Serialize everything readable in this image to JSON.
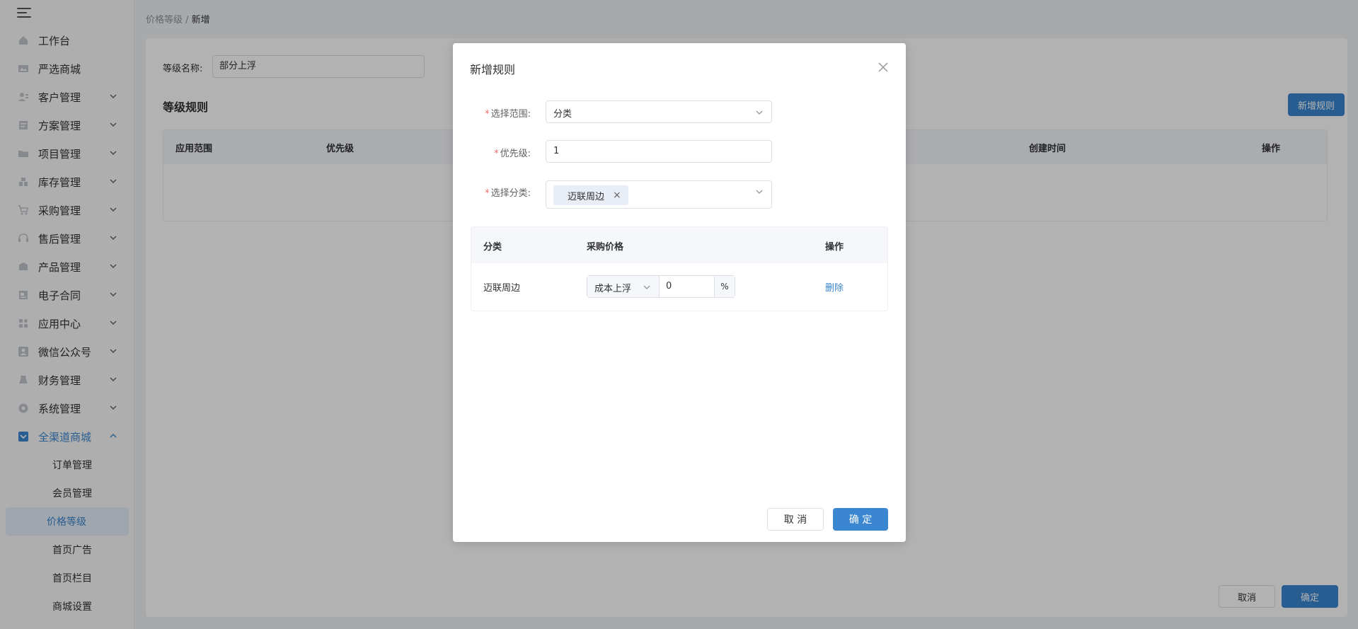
{
  "sidebar": {
    "items": [
      {
        "label": "工作台",
        "icon": "home-icon",
        "has_children": false
      },
      {
        "label": "严选商城",
        "icon": "image-icon",
        "has_children": false
      },
      {
        "label": "客户管理",
        "icon": "customer-icon",
        "has_children": true
      },
      {
        "label": "方案管理",
        "icon": "document-icon",
        "has_children": true
      },
      {
        "label": "项目管理",
        "icon": "folder-icon",
        "has_children": true
      },
      {
        "label": "库存管理",
        "icon": "inventory-icon",
        "has_children": true
      },
      {
        "label": "采购管理",
        "icon": "cart-icon",
        "has_children": true
      },
      {
        "label": "售后管理",
        "icon": "headset-icon",
        "has_children": true
      },
      {
        "label": "产品管理",
        "icon": "product-icon",
        "has_children": true
      },
      {
        "label": "电子合同",
        "icon": "contract-icon",
        "has_children": true
      },
      {
        "label": "应用中心",
        "icon": "apps-icon",
        "has_children": true
      },
      {
        "label": "微信公众号",
        "icon": "user-icon",
        "has_children": true
      },
      {
        "label": "财务管理",
        "icon": "finance-icon",
        "has_children": true
      },
      {
        "label": "系统管理",
        "icon": "settings-icon",
        "has_children": true
      },
      {
        "label": "全渠道商城",
        "icon": "mall-icon",
        "has_children": true,
        "expanded": true
      }
    ],
    "sub_items": [
      "订单管理",
      "会员管理",
      "价格等级",
      "首页广告",
      "首页栏目",
      "商城设置"
    ],
    "active_sub": "价格等级"
  },
  "breadcrumb": {
    "parent": "价格等级",
    "separator": " / ",
    "current": "新增"
  },
  "form": {
    "level_name_label": "等级名称:",
    "level_name_value": "部分上浮",
    "rules_title": "等级规则",
    "add_rule_button": "新增规则"
  },
  "rules_table": {
    "columns": [
      "应用范围",
      "优先级",
      "创建时间",
      "操作"
    ]
  },
  "page_footer": {
    "cancel": "取消",
    "confirm": "确定"
  },
  "modal": {
    "title": "新增规则",
    "fields": {
      "scope_label": "选择范围:",
      "scope_value": "分类",
      "priority_label": "优先级:",
      "priority_value": "1",
      "category_label": "选择分类:",
      "category_tag": "迈联周边"
    },
    "table": {
      "columns": [
        "分类",
        "采购价格",
        "操作"
      ],
      "rows": [
        {
          "category": "迈联周边",
          "price_mode": "成本上浮",
          "price_value": "0",
          "unit": "%",
          "action": "删除"
        }
      ]
    },
    "cancel": "取 消",
    "confirm": "确 定"
  },
  "colors": {
    "accent": "#3a86d0",
    "required": "#f56c6c",
    "overlay": "rgba(0,0,0,0.3)"
  }
}
